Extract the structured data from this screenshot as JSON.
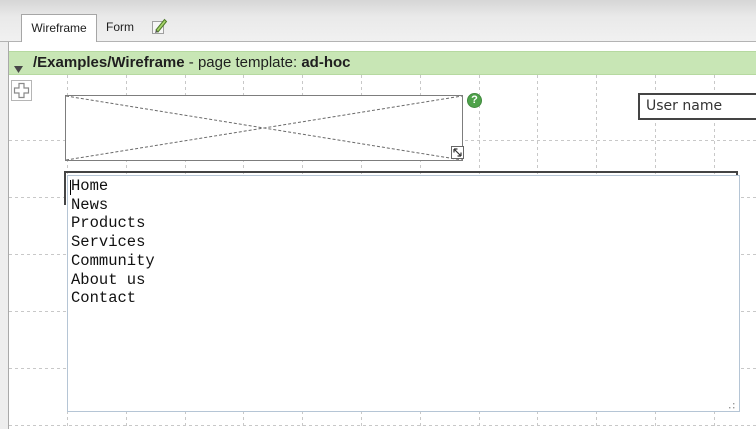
{
  "tabs": [
    {
      "label": "Wireframe",
      "active": true
    },
    {
      "label": "Form",
      "active": false
    }
  ],
  "tab_edit_icon": "pencil-icon",
  "header": {
    "collapse_icon": "triangle-down-icon",
    "path": "/Examples/Wireframe",
    "separator": " - page template: ",
    "template": "ad-hoc"
  },
  "canvas": {
    "add_widget_icon": "plus-icon",
    "image_placeholder": {
      "help_label": "?",
      "resize_icon": "resize-icon"
    },
    "user_name_field": {
      "text": "User name"
    },
    "menu_textarea": {
      "items": [
        "Home",
        "News",
        "Products",
        "Services",
        "Community",
        "About us",
        "Contact"
      ],
      "grip_icon": "resize-grip-icon"
    }
  },
  "colors": {
    "header_background": "#c8e6b5",
    "help_icon": "#4ea24a",
    "widget_border": "#444444",
    "textarea_border": "#b5c5d5",
    "grid_line": "#c8c8c8"
  }
}
